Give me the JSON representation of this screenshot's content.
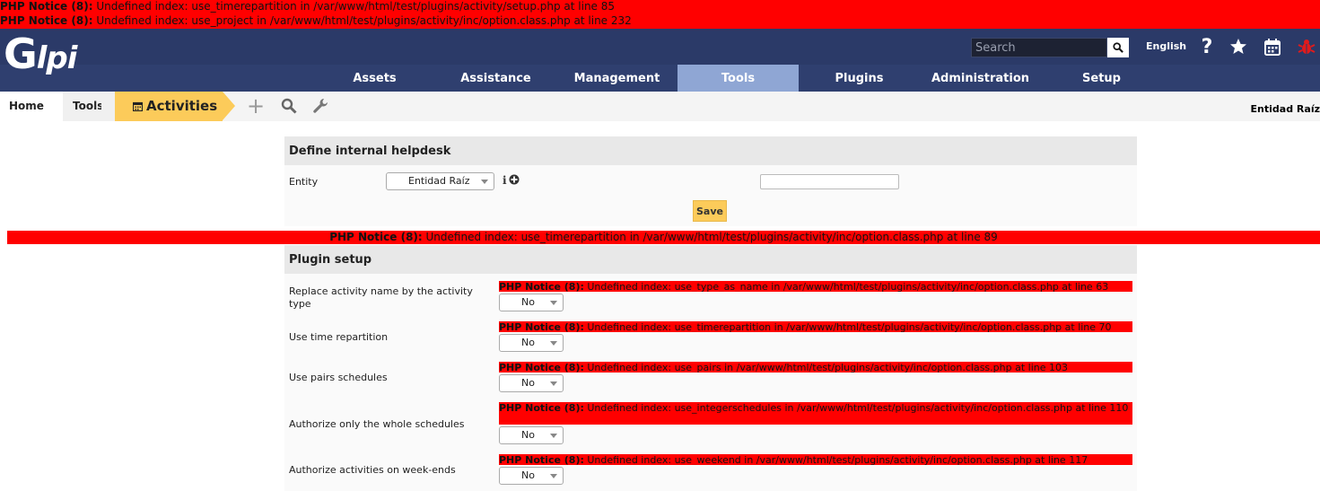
{
  "notices": {
    "top1_label": "PHP Notice (8):",
    "top1_msg": " Undefined index: use_timerepartition in /var/www/html/test/plugins/activity/setup.php at line 85",
    "top2_label": "PHP Notice (8):",
    "top2_msg": " Undefined index: use_project in /var/www/html/test/plugins/activity/inc/option.class.php at line 232",
    "mid_label": "PHP Notice (8):",
    "mid_msg": " Undefined index: use_timerepartition in /var/www/html/test/plugins/activity/inc/option.class.php at line 89"
  },
  "header": {
    "logo": "lpi",
    "logo_g": "G",
    "search_placeholder": "Search",
    "language": "English",
    "help": "?"
  },
  "menu": {
    "items": [
      "Assets",
      "Assistance",
      "Management",
      "Tools",
      "Plugins",
      "Administration",
      "Setup"
    ],
    "active": "Tools"
  },
  "breadcrumb": {
    "home": "Home",
    "tools": "Tools",
    "current": "Activities",
    "add": "+",
    "entity": "Entidad Raíz"
  },
  "helpdesk": {
    "title": "Define internal helpdesk",
    "entity_label": "Entity",
    "entity_value": "Entidad Raíz",
    "info": "i",
    "save_label": "Save"
  },
  "plugin_setup": {
    "title": "Plugin setup",
    "options": [
      {
        "label": "Replace activity name by the activity type",
        "notice_label": "PHP Notice (8):",
        "notice_msg": " Undefined index: use_type_as_name in /var/www/html/test/plugins/activity/inc/option.class.php at line 63",
        "value": "No"
      },
      {
        "label": "Use time repartition",
        "notice_label": "PHP Notice (8):",
        "notice_msg": " Undefined index: use_timerepartition in /var/www/html/test/plugins/activity/inc/option.class.php at line 70",
        "value": "No"
      },
      {
        "label": "Use pairs schedules",
        "notice_label": "PHP Notice (8):",
        "notice_msg": " Undefined index: use_pairs in /var/www/html/test/plugins/activity/inc/option.class.php at line 103",
        "value": "No"
      },
      {
        "label": "Authorize only the whole schedules",
        "notice_label": "PHP Notice (8):",
        "notice_msg": " Undefined index: use_integerschedules in /var/www/html/test/plugins/activity/inc/option.class.php at line 110",
        "value": "No"
      },
      {
        "label": "Authorize activities on week-ends",
        "notice_label": "PHP Notice (8):",
        "notice_msg": " Undefined index: use_weekend in /var/www/html/test/plugins/activity/inc/option.class.php at line 117",
        "value": "No"
      }
    ]
  },
  "colors": {
    "notice_bg": "#ff0000",
    "header_bg": "#2f3f6f",
    "active_menu": "#8fa6d4",
    "accent": "#fccb5a"
  }
}
